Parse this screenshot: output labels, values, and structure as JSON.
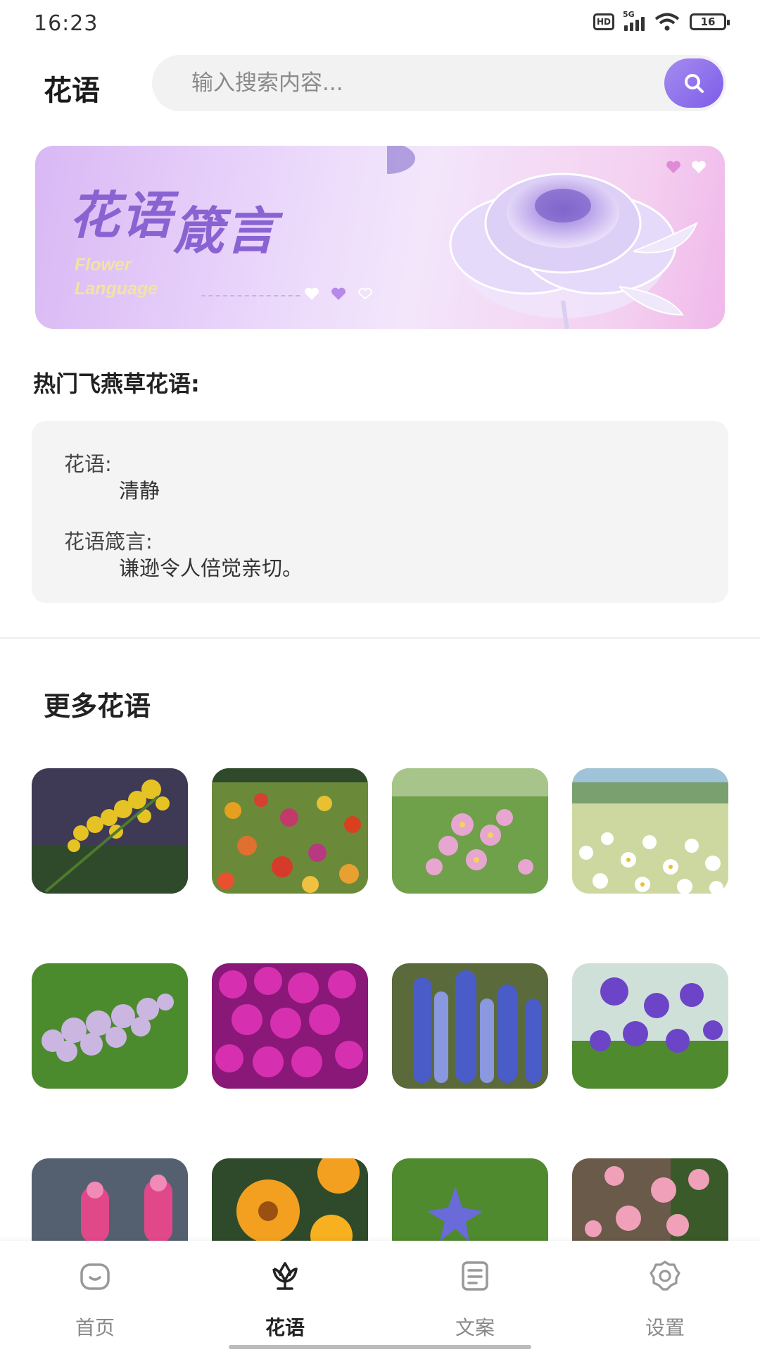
{
  "status_bar": {
    "time": "16:23",
    "hd": "HD",
    "network": "5G",
    "battery": "16"
  },
  "header": {
    "title": "花语",
    "search_placeholder": "输入搜索内容..."
  },
  "banner": {
    "title_part1": "花语",
    "title_part2": "箴言",
    "subtitle_line1": "Flower",
    "subtitle_line2": "Language"
  },
  "hot": {
    "heading": "热门飞燕草花语:",
    "label1": "花语:",
    "value1": "清静",
    "label2": "花语箴言:",
    "value2": "谦逊令人倍觉亲切。"
  },
  "more": {
    "heading": "更多花语",
    "flowers": [
      {
        "icon": "goldenrod-flower"
      },
      {
        "icon": "zinnia-field"
      },
      {
        "icon": "cosmos-flower"
      },
      {
        "icon": "daisy-field"
      },
      {
        "icon": "lilac-flower"
      },
      {
        "icon": "phlox-flower"
      },
      {
        "icon": "delphinium-flower"
      },
      {
        "icon": "bellflower"
      },
      {
        "icon": "snapdragon-flower"
      },
      {
        "icon": "calendula-flower"
      },
      {
        "icon": "balloon-flower"
      },
      {
        "icon": "carnation-flower"
      }
    ]
  },
  "nav": [
    {
      "label": "首页",
      "icon": "home-icon",
      "active": false
    },
    {
      "label": "花语",
      "icon": "flower-icon",
      "active": true
    },
    {
      "label": "文案",
      "icon": "document-icon",
      "active": false
    },
    {
      "label": "设置",
      "icon": "gear-icon",
      "active": false
    }
  ],
  "colors": {
    "accent": "#8a63d2",
    "card_bg": "#f4f4f4",
    "search_btn": "#7d5ce8"
  }
}
